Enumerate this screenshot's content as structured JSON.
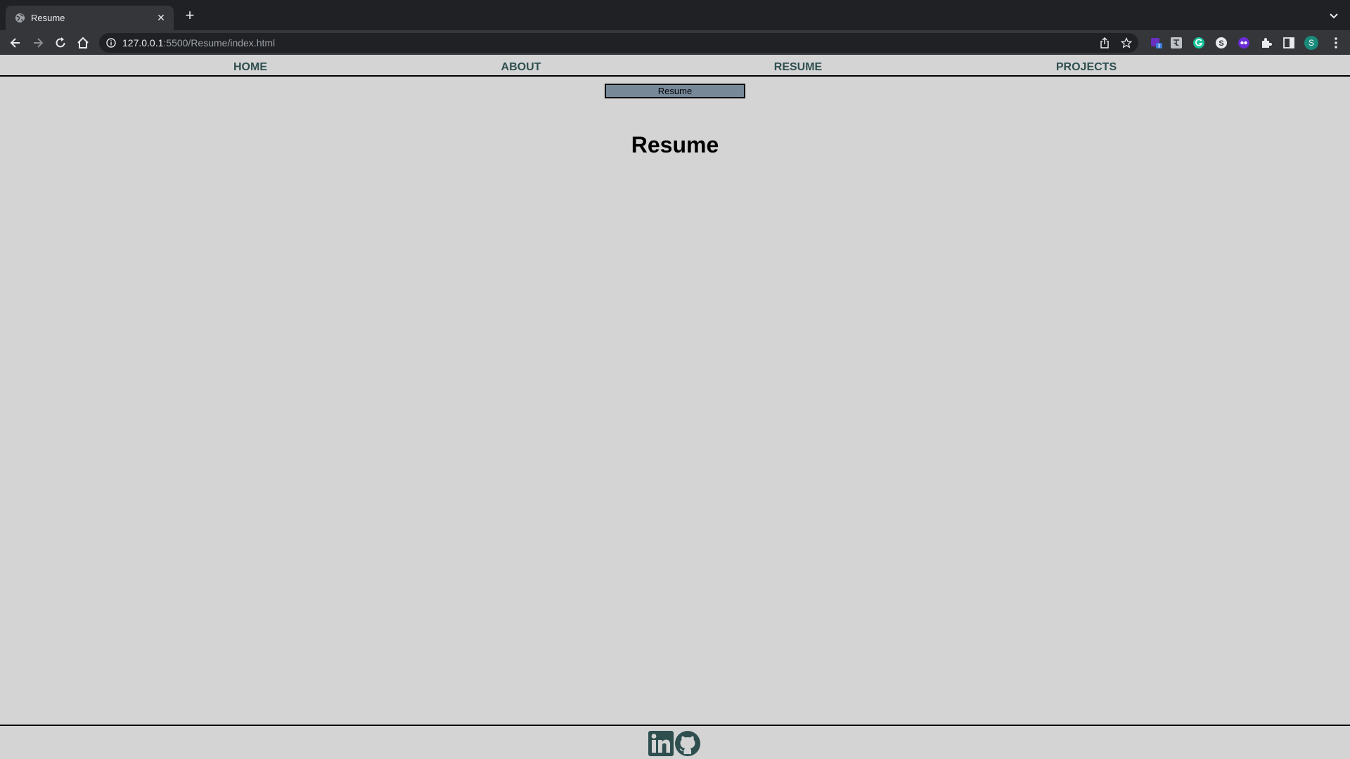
{
  "browser": {
    "tab_title": "Resume",
    "url_host": "127.0.0.1",
    "url_rest": ":5500/Resume/index.html",
    "avatar_letter": "S"
  },
  "site": {
    "nav": [
      "HOME",
      "ABOUT",
      "RESUME",
      "PROJECTS"
    ],
    "resume_button": "Resume",
    "heading": "Resume"
  },
  "colors": {
    "page_bg": "#d4d4d4",
    "nav_text": "#2f4f4f",
    "button_bg": "#778899",
    "chrome_dark": "#202124",
    "chrome_toolbar": "#35363a"
  },
  "icons": {
    "footer": [
      "linkedin-icon",
      "github-icon"
    ]
  }
}
